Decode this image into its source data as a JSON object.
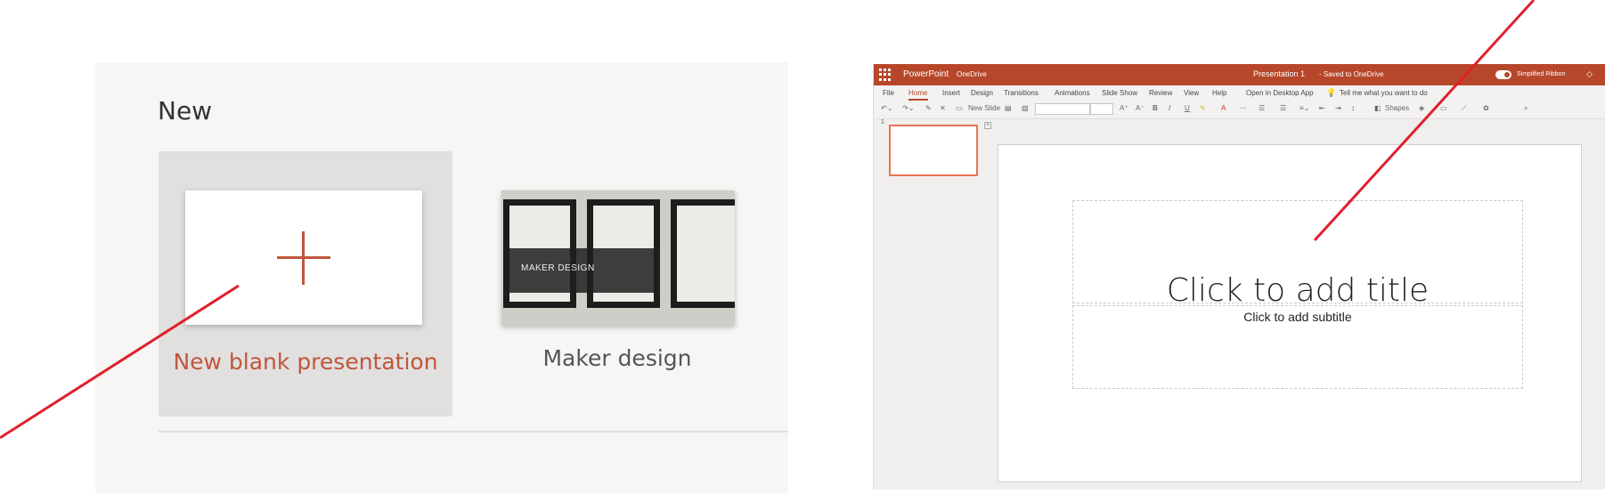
{
  "left": {
    "heading": "New",
    "blank_label": "New blank presentation",
    "maker_label": "Maker design",
    "maker_band_text": "MAKER DESIGN"
  },
  "app": {
    "app_name": "PowerPoint",
    "location": "OneDrive",
    "doc_title": "Presentation 1",
    "status": "-   Saved to OneDrive",
    "simplified_ribbon": "Simplified Ribbon",
    "menu": [
      "File",
      "Home",
      "Insert",
      "Design",
      "Transitions",
      "Animations",
      "Slide Show",
      "Review",
      "View",
      "Help",
      "Open in Desktop App",
      "Tell me what you want to do"
    ],
    "toolbar_new_slide": "New Slide",
    "toolbar_shapes": "Shapes",
    "slide_number": "1",
    "title_placeholder": "Click to add title",
    "subtitle_placeholder": "Click to add subtitle"
  },
  "colors": {
    "accent": "#b7472a",
    "annotation": "#e0202b"
  }
}
